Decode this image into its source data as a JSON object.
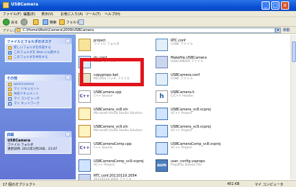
{
  "window": {
    "title": "USBCamera"
  },
  "menu": [
    "ファイル(F)",
    "編集(E)",
    "表示(V)",
    "お気に入り(A)",
    "ツール(T)",
    "ヘルプ(H)"
  ],
  "toolbar": {
    "back_label": "戻る",
    "search_label": "検索",
    "folders_label": "フォルダ"
  },
  "address": {
    "label": "アドレス(D)",
    "path": "C:\\Home\\Work\\Camera\\2009\\USBCamera",
    "go_label": "移動"
  },
  "left_pane": {
    "tasks": {
      "title": "ファイルとフォルダのタスク",
      "items": [
        "新しいフォルダを作成する",
        "このフォルダを Web に公開する",
        "このフォルダを共有する"
      ]
    },
    "places": {
      "title": "その他",
      "items": [
        "work\\camera",
        "マイ ドキュメント",
        "共有ドキュメント",
        "マイ コンピュータ",
        "マイ ネットワーク"
      ]
    },
    "details": {
      "title": "詳細",
      "name": "USBCamera",
      "type": "ファイル フォルダ",
      "modified": "更新日時: 2011年1月19日、21:07"
    }
  },
  "files": [
    {
      "name": "project",
      "sub": "ファイル フォルダ",
      "icon": "folder",
      "glyph": ""
    },
    {
      "name": "RTC.conf",
      "sub": "CONF ファイル",
      "icon": "config",
      "glyph": ""
    },
    {
      "name": "rtc.conf",
      "sub": "CONF ファイル",
      "icon": "config",
      "glyph": ""
    },
    {
      "name": "Makefile.USBCamera",
      "sub": "USBCAMERA ファイル",
      "icon": "generic",
      "glyph": ""
    },
    {
      "name": "copyprops.bat",
      "sub": "MS-DOS バッチ ファイル",
      "icon": "batch",
      "glyph": ""
    },
    {
      "name": "USBCamera.conf",
      "sub": "CONF ファイル",
      "icon": "config",
      "glyph": ""
    },
    {
      "name": "USBCamera.cpp",
      "sub": "C++ Source",
      "icon": "cpp",
      "glyph": "C++"
    },
    {
      "name": "USBCamera.h",
      "sub": "C/C++ Header",
      "icon": "header",
      "glyph": "h"
    },
    {
      "name": "USBCamera_vc8.sln",
      "sub": "Microsoft Visual Studio Solution",
      "icon": "solution",
      "glyph": ""
    },
    {
      "name": "USBCamera_vc8.vcproj",
      "sub": "VC++ Project",
      "icon": "vcproj",
      "glyph": ""
    },
    {
      "name": "USBCamera_vc9.sln",
      "sub": "Microsoft Visual Studio Solution",
      "icon": "solution",
      "glyph": ""
    },
    {
      "name": "USBCamera_vc9.vcproj",
      "sub": "VC++ Project",
      "icon": "vcproj",
      "glyph": ""
    },
    {
      "name": "USBCameraComp.cpp",
      "sub": "C++ Source",
      "icon": "cpp",
      "glyph": "C++"
    },
    {
      "name": "USBCameraComp_vc8.vcproj",
      "sub": "VC++ Project",
      "icon": "vcproj",
      "glyph": ""
    },
    {
      "name": "USBCameraComp_vc9.vcproj",
      "sub": "VC++ Project",
      "icon": "vcproj",
      "glyph": ""
    },
    {
      "name": "user_config.vsprops",
      "sub": "Property Sheets File",
      "icon": "vsprops",
      "glyph": "asm"
    },
    {
      "name": "RTC.conf.20110119.2054",
      "sub": "20110119.2054 ファイル",
      "icon": "generic",
      "glyph": ""
    }
  ],
  "status": {
    "left": "17 個のオブジェクト",
    "size": "451 KB",
    "location": "マイ コンピュータ"
  },
  "colors": {
    "highlight": "#e1141b",
    "titlebar": "#0b52d4",
    "taskpane": "#6375d6"
  }
}
